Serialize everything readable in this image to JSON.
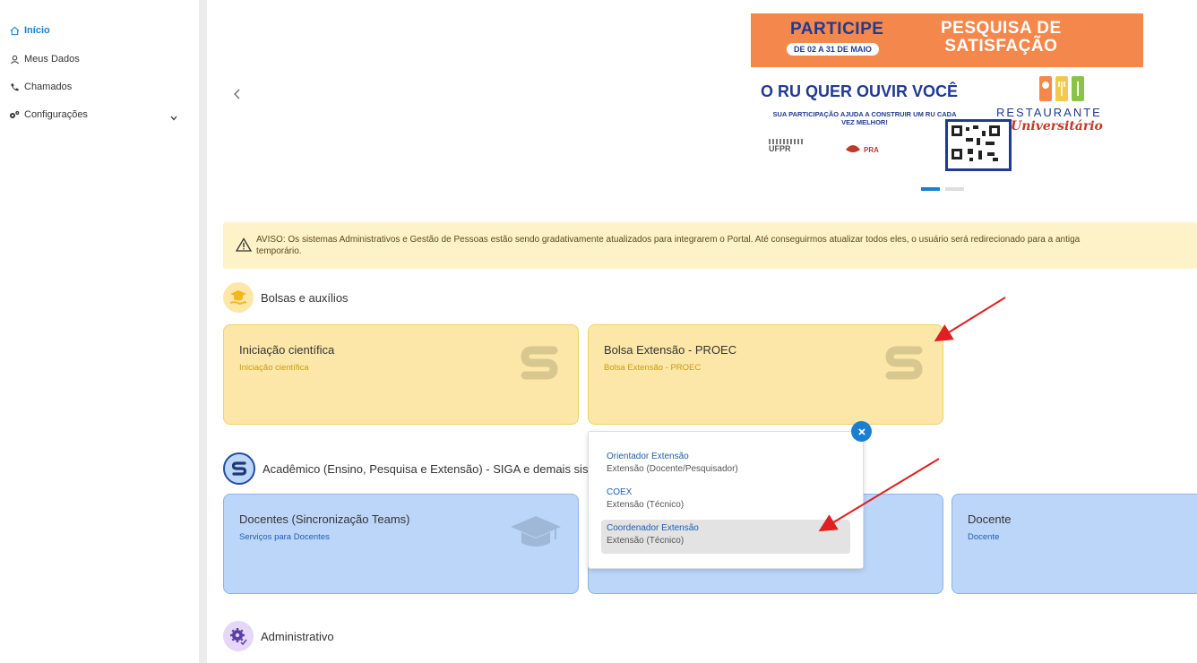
{
  "sidebar": {
    "items": [
      {
        "label": "Início",
        "icon": "home-icon"
      },
      {
        "label": "Meus Dados",
        "icon": "user-icon"
      },
      {
        "label": "Chamados",
        "icon": "phone-icon"
      },
      {
        "label": "Configurações",
        "icon": "gears-icon"
      }
    ]
  },
  "banner": {
    "participe": "PARTICIPE",
    "date": "DE 02 A 31 DE MAIO",
    "pesquisa_line1": "PESQUISA DE",
    "pesquisa_line2": "SATISFAÇÃO",
    "headline": "O RU QUER OUVIR VOCÊ",
    "subtext": "SUA PARTICIPAÇÃO AJUDA A CONSTRUIR UM RU CADA VEZ MELHOR!",
    "restaurante": "RESTAURANTE",
    "universitario": "Universitário",
    "ufpr": "UFPR",
    "pra": "PRA"
  },
  "alert": {
    "text": "AVISO: Os sistemas Administrativos e Gestão de Pessoas estão sendo gradativamente atualizados para integrarem o Portal. Até conseguirmos atualizar todos eles, o usuário será redirecionado para a antiga\ntemporário."
  },
  "sections": {
    "bolsas": {
      "title": "Bolsas e auxílios",
      "cards": [
        {
          "title": "Iniciação científica",
          "sub": "Iniciação científica"
        },
        {
          "title": "Bolsa Extensão - PROEC",
          "sub": "Bolsa Extensão - PROEC"
        }
      ]
    },
    "academico": {
      "title": "Acadêmico (Ensino, Pesquisa e Extensão) - SIGA e demais sis",
      "cards": [
        {
          "title": "Docentes (Sincronização Teams)",
          "sub": "Serviços para Docentes"
        },
        {
          "title": "Docente",
          "sub": "Docente"
        }
      ]
    },
    "administrativo": {
      "title": "Administrativo"
    }
  },
  "popup": {
    "items": [
      {
        "label": "Orientador Extensão",
        "sub": "Extensão (Docente/Pesquisador)"
      },
      {
        "label": "COEX",
        "sub": "Extensão (Técnico)"
      },
      {
        "label": "Coordenador Extensão",
        "sub": "Extensão (Técnico)"
      }
    ]
  },
  "colors": {
    "accent": "#1a7fd0",
    "yellow_card": "#fde7a8",
    "blue_card": "#bcd6f9",
    "alert_bg": "#fdf2c8",
    "annotation_arrow": "#e02020"
  }
}
